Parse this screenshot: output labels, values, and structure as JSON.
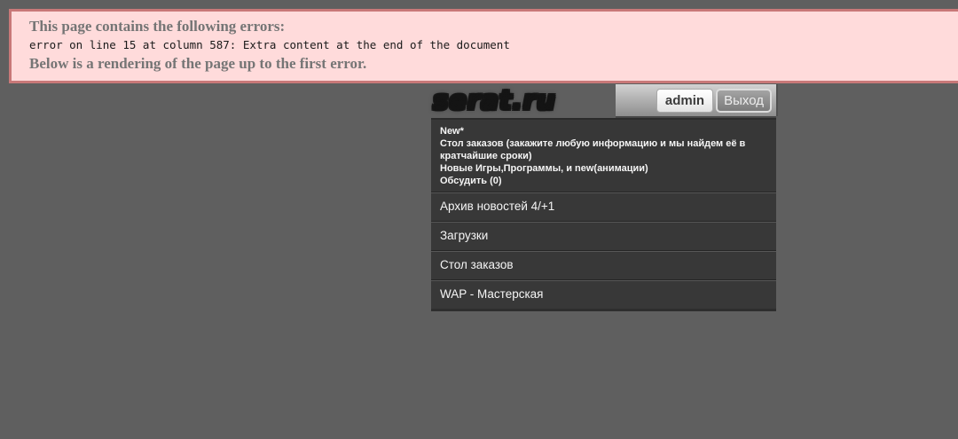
{
  "error_banner": {
    "heading": "This page contains the following errors:",
    "error_detail": "error on line 15 at column 587: Extra content at the end of the document",
    "subheading": "Below is a rendering of the page up to the first error."
  },
  "header": {
    "logo_text": "serat.ru",
    "username": "admin",
    "logout_label": "Выход"
  },
  "menu": {
    "news_block": {
      "badge": "New*",
      "lines": [
        "Стол заказов (закажите любую информацию и мы найдем её в кратчайшие сроки)",
        "Новые Игры,Программы, и new(анимации)",
        "Обсудить (0)"
      ]
    },
    "items": [
      {
        "label": "Архив новостей 4/+1"
      },
      {
        "label": "Загрузки"
      },
      {
        "label": "Стол заказов"
      },
      {
        "label": "WAP - Мастерская"
      }
    ]
  },
  "colors": {
    "page_background": "#5f5f5f",
    "banner_background": "#ffdbdb",
    "banner_border": "#c87878",
    "banner_heading_text": "#757575",
    "menu_background": "#373737",
    "menu_text": "#f5f5f5",
    "user_bar_gradient_top": "#d2d2d2",
    "user_bar_gradient_bottom": "#8e8e8e"
  }
}
